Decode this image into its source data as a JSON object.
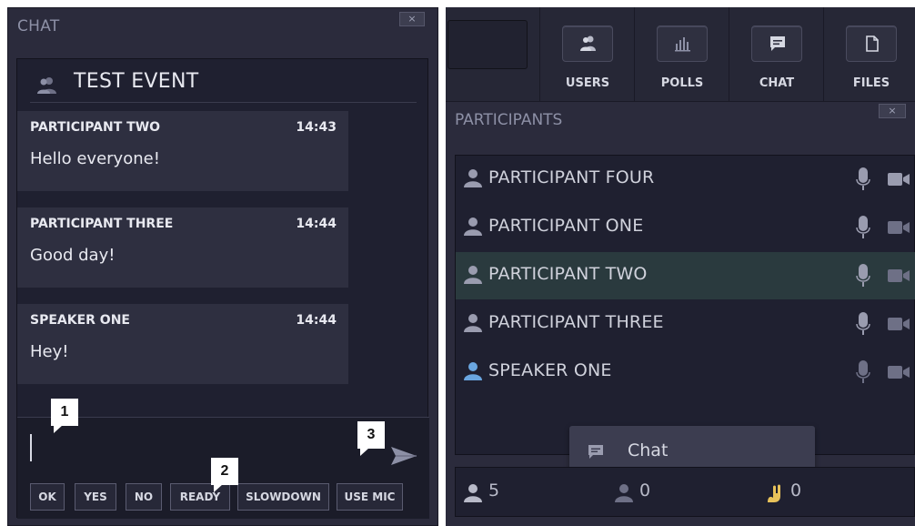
{
  "chat": {
    "title": "CHAT",
    "close": "×",
    "event_title": "TEST EVENT",
    "messages": [
      {
        "sender": "PARTICIPANT TWO",
        "time": "14:43",
        "text": "Hello everyone!"
      },
      {
        "sender": "PARTICIPANT THREE",
        "time": "14:44",
        "text": "Good day!"
      },
      {
        "sender": "SPEAKER ONE",
        "time": "14:44",
        "text": "Hey!"
      }
    ],
    "input_value": "",
    "quick_replies": [
      "OK",
      "YES",
      "NO",
      "READY",
      "SLOWDOWN",
      "USE MIC"
    ],
    "callouts": [
      "1",
      "2",
      "3"
    ]
  },
  "toolbar": {
    "buttons": [
      {
        "label": "USERS",
        "icon": "users-icon"
      },
      {
        "label": "POLLS",
        "icon": "polls-icon"
      },
      {
        "label": "CHAT",
        "icon": "chat-icon"
      },
      {
        "label": "FILES",
        "icon": "files-icon"
      }
    ]
  },
  "participants": {
    "title": "PARTICIPANTS",
    "close": "×",
    "list": [
      {
        "name": "PARTICIPANT FOUR",
        "role": "participant"
      },
      {
        "name": "PARTICIPANT ONE",
        "role": "participant"
      },
      {
        "name": "PARTICIPANT TWO",
        "role": "participant",
        "selected": true
      },
      {
        "name": "PARTICIPANT THREE",
        "role": "participant"
      },
      {
        "name": "SPEAKER ONE",
        "role": "speaker"
      }
    ],
    "context_menu": {
      "label": "Chat"
    },
    "status": {
      "total": "5",
      "inactive": "0",
      "hands_raised": "0"
    }
  },
  "colors": {
    "panel_bg": "#2b2b3c",
    "inner_bg": "#1f2030",
    "speaker_icon": "#6aa6e0",
    "hand_icon": "#e8c25a",
    "selected_row": "#2a3a3e"
  }
}
